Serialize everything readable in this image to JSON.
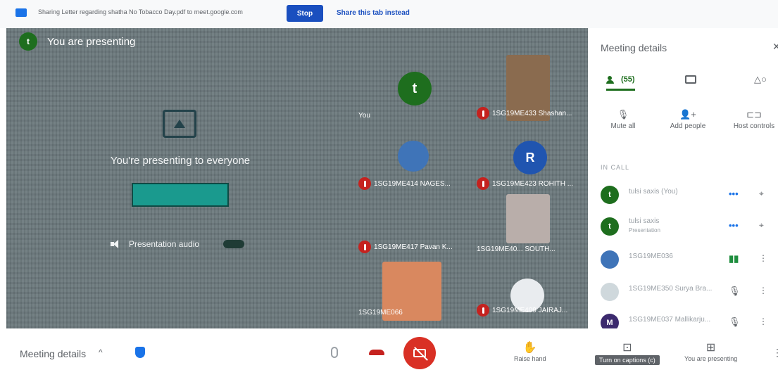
{
  "share_bar": {
    "message": "Sharing Letter regarding shatha No Tobacco Day.pdf to meet.google.com",
    "stop_label": "Stop",
    "share_instead_label": "Share this tab instead"
  },
  "stage": {
    "presenter_chip": {
      "initial": "t",
      "label": "You are presenting"
    },
    "presenting_text": "You're presenting to everyone",
    "audio_label": "Presentation audio",
    "tiles": [
      {
        "initial": "t",
        "name": "You",
        "muted": false
      },
      {
        "name": "1SG19ME433 Shashan...",
        "muted": true
      },
      {
        "name": "1SG19ME414 NAGES...",
        "muted": true
      },
      {
        "initial": "R",
        "name": "1SG19ME423 ROHITH ...",
        "muted": true
      },
      {
        "name": "1SG19ME417 Pavan K...",
        "muted": true
      },
      {
        "name": "1SG19ME40... SOUTH...",
        "muted": false
      },
      {
        "name": "1SG19ME066",
        "muted": false
      },
      {
        "name": "1SG19ME409 JAIRAJ...",
        "muted": true
      }
    ]
  },
  "sidebar": {
    "title": "Meeting details",
    "close_icon": "close-icon",
    "people_count": "(55)",
    "actions": [
      {
        "label": "Mute all",
        "icon": "mute-all-icon"
      },
      {
        "label": "Add people",
        "icon": "add-person-icon"
      },
      {
        "label": "Host controls",
        "icon": "host-controls-icon"
      }
    ],
    "section_label": "IN CALL",
    "participants": [
      {
        "initial": "t",
        "name": "tulsi saxis (You)",
        "sub": ""
      },
      {
        "initial": "t",
        "name": "tulsi saxis",
        "sub": "Presentation"
      },
      {
        "initial": "",
        "name": "1SG19ME036",
        "sub": ""
      },
      {
        "initial": "",
        "name": "1SG19ME350 Surya Bra...",
        "sub": ""
      },
      {
        "initial": "M",
        "name": "1SG19ME037 Mallikarju...",
        "sub": ""
      }
    ]
  },
  "bottom_bar": {
    "meeting_details_label": "Meeting details",
    "raise_hand_label": "Raise hand",
    "captions_label": "Turn on captions (c)",
    "presenting_label": "You are presenting"
  }
}
